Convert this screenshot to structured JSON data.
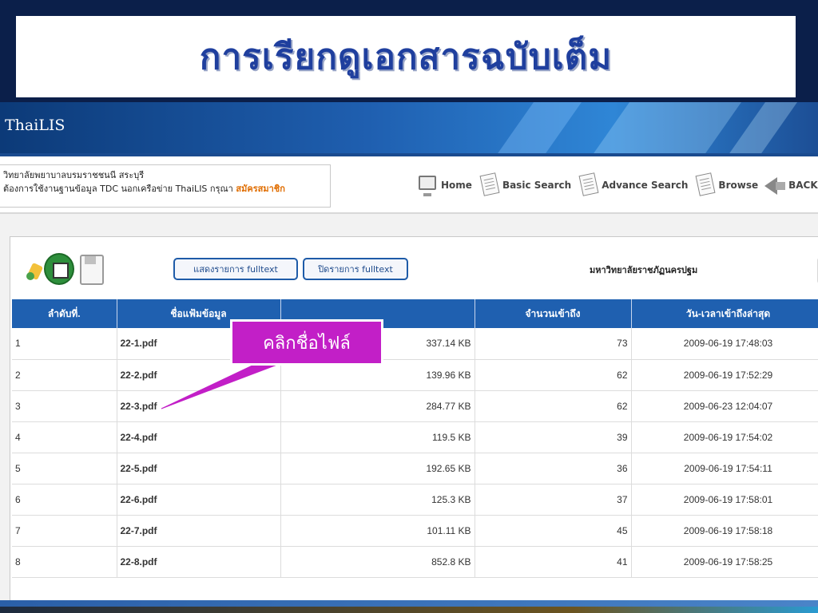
{
  "slide": {
    "title": "การเรียกดูเอกสารฉบับเต็ม"
  },
  "site": {
    "logo": "ThaiLIS",
    "info_line1": "วิทยาลัยพยาบาลบรมราชชนนี สระบุรี",
    "info_line2": "ต้องการใช้งานฐานข้อมูล TDC นอกเครือข่าย ThaiLIS กรุณา",
    "register_link": "สมัครสมาชิก"
  },
  "nav": {
    "items": [
      {
        "label": "Home",
        "icon": "monitor-icon"
      },
      {
        "label": "Basic Search",
        "icon": "document-icon"
      },
      {
        "label": "Advance Search",
        "icon": "document-icon"
      },
      {
        "label": "Browse",
        "icon": "documents-icon"
      },
      {
        "label": "BACK",
        "icon": "back-arrow-icon"
      }
    ]
  },
  "toolbar": {
    "show_fulltext": "แสดงรายการ fulltext",
    "close_fulltext": "ปิดรายการ fulltext",
    "university": "มหาวิทยาลัยราชภัฏนครปฐม"
  },
  "table": {
    "headers": [
      "ลำดับที่.",
      "ชื่อแฟ้มข้อมูล",
      "",
      "จำนวนเข้าถึง",
      "วัน-เวลาเข้าถึงล่าสุด"
    ],
    "rows": [
      {
        "no": "1",
        "file": "22-1.pdf",
        "size": "337.14 KB",
        "hits": "73",
        "date": "2009-06-19 17:48:03"
      },
      {
        "no": "2",
        "file": "22-2.pdf",
        "size": "139.96 KB",
        "hits": "62",
        "date": "2009-06-19 17:52:29"
      },
      {
        "no": "3",
        "file": "22-3.pdf",
        "size": "284.77 KB",
        "hits": "62",
        "date": "2009-06-23 12:04:07"
      },
      {
        "no": "4",
        "file": "22-4.pdf",
        "size": "119.5 KB",
        "hits": "39",
        "date": "2009-06-19 17:54:02"
      },
      {
        "no": "5",
        "file": "22-5.pdf",
        "size": "192.65 KB",
        "hits": "36",
        "date": "2009-06-19 17:54:11"
      },
      {
        "no": "6",
        "file": "22-6.pdf",
        "size": "125.3 KB",
        "hits": "37",
        "date": "2009-06-19 17:58:01"
      },
      {
        "no": "7",
        "file": "22-7.pdf",
        "size": "101.11 KB",
        "hits": "45",
        "date": "2009-06-19 17:58:18"
      },
      {
        "no": "8",
        "file": "22-8.pdf",
        "size": "852.8 KB",
        "hits": "41",
        "date": "2009-06-19 17:58:25"
      }
    ]
  },
  "callout": {
    "text": "คลิกชื่อไฟล์"
  },
  "colors": {
    "title": "#1f3f9e",
    "header_blue": "#1f60b0",
    "file_link": "#e57c00",
    "callout": "#c21fc7"
  }
}
